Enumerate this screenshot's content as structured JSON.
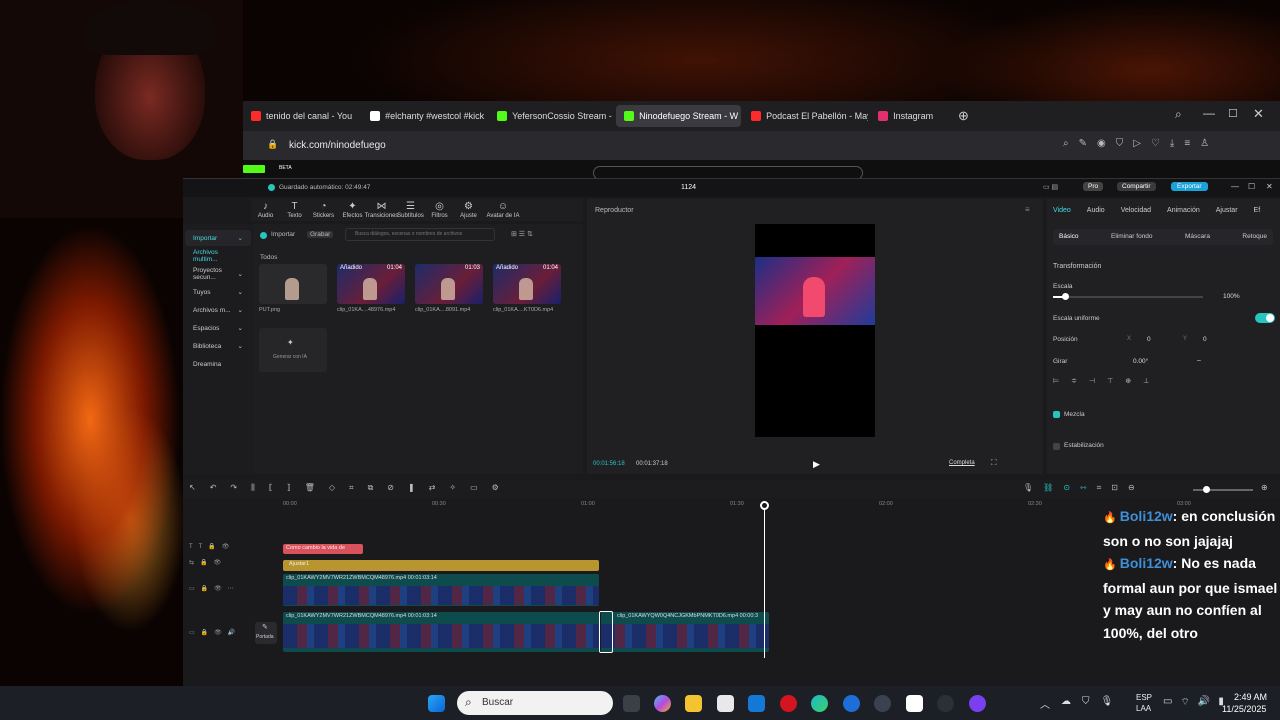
{
  "browser": {
    "tabs": [
      {
        "label": "tenido del canal - You",
        "fav": "youtube-icon",
        "color": "#ff2b2b"
      },
      {
        "label": "#elchanty #westcol #kick",
        "fav": "tiktok-icon",
        "color": "#ffffff"
      },
      {
        "label": "YefersonCossio Stream - V",
        "fav": "kick-icon",
        "color": "#53fc18"
      },
      {
        "label": "Ninodefuego Stream - W",
        "fav": "kick-icon",
        "color": "#53fc18",
        "active": true
      },
      {
        "label": "Podcast El Pabellón - May",
        "fav": "youtube-icon",
        "color": "#ff2b2b"
      },
      {
        "label": "Instagram",
        "fav": "instagram-icon",
        "color": "#e1306c"
      }
    ],
    "url": "kick.com/ninodefuego",
    "beta": "BETA"
  },
  "editor": {
    "autosave": "Guardado automático: 02:49:47",
    "project_title": "1124",
    "pro_label": "Pro",
    "share_label": "Compartir",
    "export_label": "Exportar",
    "toolbar": [
      "Audio",
      "Texto",
      "Stickers",
      "Efectos",
      "Transiciones",
      "Subtítulos",
      "Filtros",
      "Ajuste",
      "Avatar de IA"
    ],
    "nav": [
      "Importar",
      "Archivos multim...",
      "Proyectos secun...",
      "Tuyos",
      "Archivos m...",
      "Espacios",
      "Biblioteca",
      "Dreamina"
    ],
    "import_btn": "Importar",
    "record_btn": "Grabar",
    "search_placeholder": "Busca diálogos, escenas o nombres de archivos",
    "all_label": "Todos",
    "media": [
      {
        "name": "PUT.png",
        "badge": "",
        "dur": ""
      },
      {
        "name": "clip_01KA....48976.mp4",
        "badge": "Añadido",
        "dur": "01:04"
      },
      {
        "name": "clip_01KA....8091.mp4",
        "badge": "",
        "dur": "01:03"
      },
      {
        "name": "clip_01KA....KT0D6.mp4",
        "badge": "Añadido",
        "dur": "01:04"
      }
    ],
    "generate_ai": "Generar con IA",
    "player": {
      "title": "Reproductor",
      "current": "00:01:56:18",
      "total": "00:01:37:18",
      "ratio_label": "Completa"
    },
    "right": {
      "tabs": [
        "Video",
        "Audio",
        "Velocidad",
        "Animación",
        "Ajustar",
        "Ef"
      ],
      "subtabs": [
        "Básico",
        "Eliminar fondo",
        "Máscara",
        "Retoque"
      ],
      "transform": "Transformación",
      "scale_label": "Escala",
      "scale_value": "100%",
      "scale_fraction": 0.08,
      "uniform_label": "Escala uniforme",
      "position_label": "Posición",
      "pos_x_label": "X",
      "pos_x": "0",
      "pos_y_label": "Y",
      "pos_y": "0",
      "rotate_label": "Girar",
      "rotate_value": "0.00°",
      "rotate_dash": "–",
      "blend_label": "Mezcla",
      "stabilize_label": "Estabilización"
    },
    "timeline": {
      "ticks": [
        "00:00",
        "00:30",
        "01:00",
        "01:30",
        "02:00",
        "02:30",
        "03:00"
      ],
      "text_track": "Como cambio la vida de",
      "adjust_track": "Ajustar1",
      "clip1": "clip_01KAWY2MV7WR21ZWBMCQM48976.mp4  00:01:03:14",
      "clip2": "clip_01KAWY2MV7WR21ZWBMCQM48976.mp4  00:01:03:14",
      "clip3": "clip_01KAWYQW0Q4NCJGKMbPNMKT0D6.mp4  00:00:3",
      "cover_label": "Portada"
    }
  },
  "chat": [
    {
      "user": "Boli12w",
      "message": ": en conclusión son o no son jajajaj"
    },
    {
      "user": "Boli12w",
      "message": ": No es nada formal aun por que ismael y may aun no confíen al 100%, del otro"
    }
  ],
  "taskbar": {
    "search_placeholder": "Buscar",
    "lang1": "ESP",
    "lang2": "LAA",
    "time": "2:49 AM",
    "date": "11/25/2025"
  }
}
